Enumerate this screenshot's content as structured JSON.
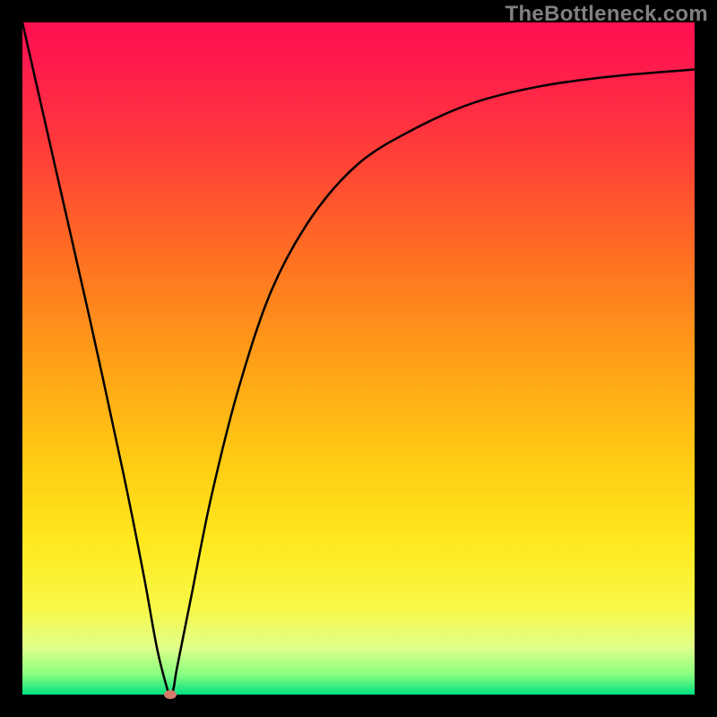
{
  "watermark": "TheBottleneck.com",
  "chart_data": {
    "type": "line",
    "title": "",
    "xlabel": "",
    "ylabel": "",
    "xlim": [
      0,
      100
    ],
    "ylim": [
      0,
      100
    ],
    "grid": false,
    "series": [
      {
        "name": "bottleneck-curve",
        "x": [
          0,
          5,
          10,
          15,
          18,
          20,
          21.5,
          22,
          22.5,
          23,
          25,
          28,
          32,
          37,
          43,
          50,
          58,
          67,
          77,
          88,
          100
        ],
        "values": [
          100,
          78,
          56,
          33,
          18,
          7,
          1,
          0,
          1,
          4,
          14,
          29,
          45,
          60,
          71,
          79,
          84,
          88,
          90.5,
          92,
          93
        ]
      }
    ],
    "marker": {
      "x": 22,
      "y": 0
    },
    "gradient_stops": [
      {
        "pos": 0,
        "color": "#ff1050"
      },
      {
        "pos": 0.5,
        "color": "#ffc818"
      },
      {
        "pos": 0.9,
        "color": "#f8f846"
      },
      {
        "pos": 1,
        "color": "#00e080"
      }
    ]
  }
}
